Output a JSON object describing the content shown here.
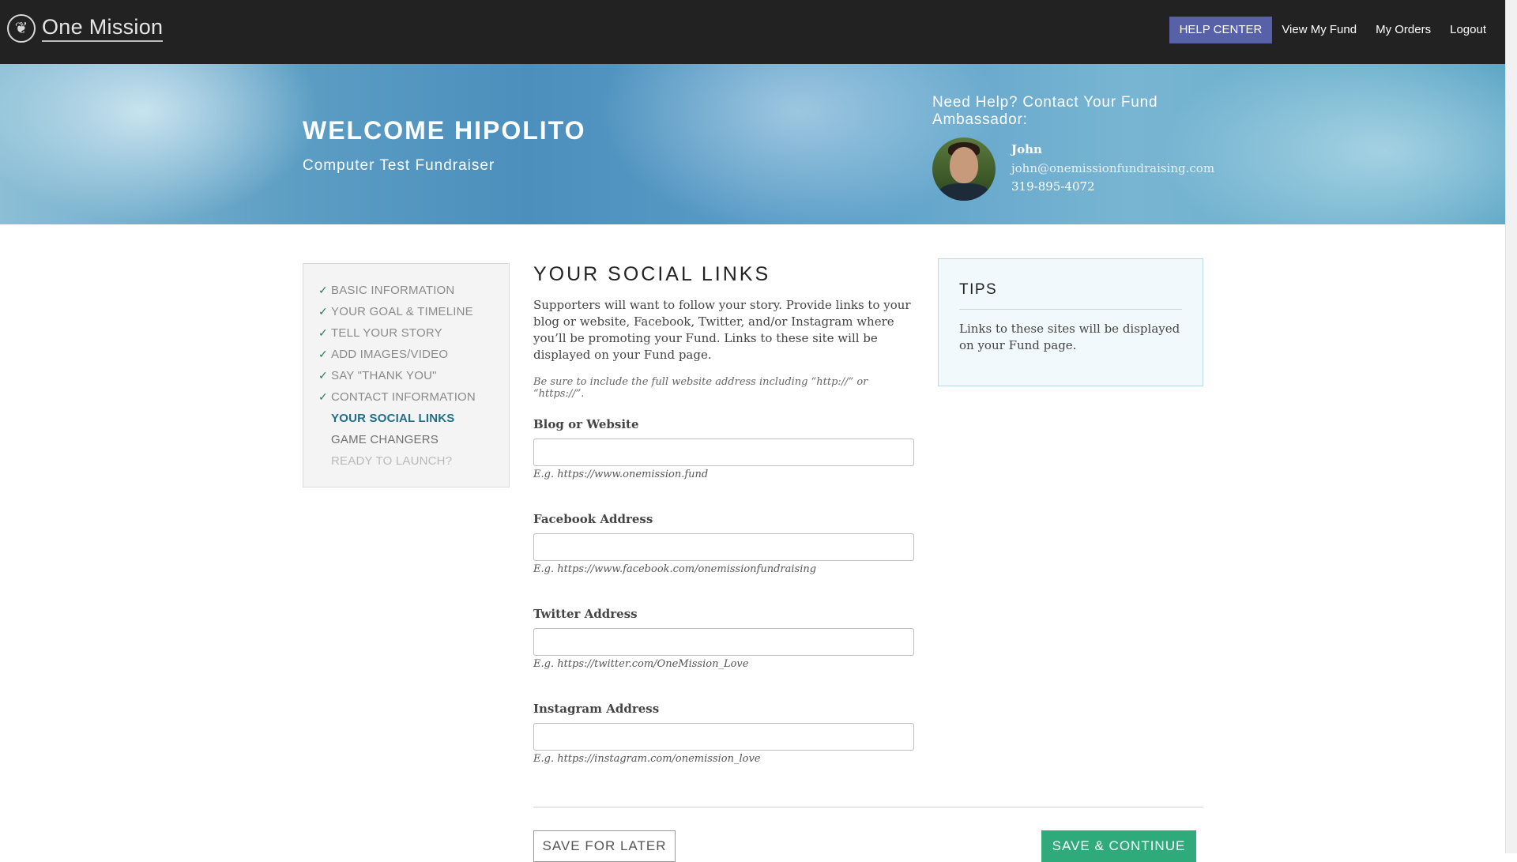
{
  "header": {
    "logo_text": "One Mission",
    "nav": {
      "help_center": "HELP CENTER",
      "view_my_fund": "View My Fund",
      "my_orders": "My Orders",
      "logout": "Logout"
    },
    "colors": {
      "bar": "#222222",
      "help_button": "#5661a8"
    }
  },
  "hero": {
    "welcome": "WELCOME HIPOLITO",
    "fund_name": "Computer Test Fundraiser",
    "help_title": "Need Help? Contact Your Fund Ambassador:",
    "ambassador": {
      "name": "John",
      "email": "john@onemissionfundraising.com",
      "phone": "319-895-4072"
    }
  },
  "steps": [
    {
      "label": "BASIC INFORMATION",
      "state": "done"
    },
    {
      "label": "YOUR GOAL & TIMELINE",
      "state": "done"
    },
    {
      "label": "TELL YOUR STORY",
      "state": "done"
    },
    {
      "label": "ADD IMAGES/VIDEO",
      "state": "done"
    },
    {
      "label": "SAY \"THANK YOU\"",
      "state": "done"
    },
    {
      "label": "CONTACT INFORMATION",
      "state": "done"
    },
    {
      "label": "YOUR SOCIAL LINKS",
      "state": "active"
    },
    {
      "label": "GAME CHANGERS",
      "state": "pending"
    },
    {
      "label": "READY TO LAUNCH?",
      "state": "disabled"
    }
  ],
  "main": {
    "title": "YOUR SOCIAL LINKS",
    "intro": "Supporters will want to follow your story. Provide links to your blog or website, Facebook, Twitter, and/or Instagram where you’ll be promoting your Fund. Links to these site will be displayed on your Fund page.",
    "note": "Be sure to include the full website address including “http://” or “https://”.",
    "fields": [
      {
        "label": "Blog or Website",
        "value": "",
        "hint": "E.g. https://www.onemission.fund"
      },
      {
        "label": "Facebook Address",
        "value": "",
        "hint": "E.g. https://www.facebook.com/onemissionfundraising"
      },
      {
        "label": "Twitter Address",
        "value": "",
        "hint": "E.g. https://twitter.com/OneMission_Love"
      },
      {
        "label": "Instagram Address",
        "value": "",
        "hint": "E.g. https://instagram.com/onemission_love"
      }
    ],
    "save_later": "SAVE FOR LATER",
    "save_continue": "SAVE & CONTINUE"
  },
  "tips": {
    "title": "TIPS",
    "text": "Links to these sites will be displayed on your Fund page."
  },
  "check_glyph": "✓",
  "colors": {
    "active_step": "#1f6f86",
    "continue_button": "#2eaa7b",
    "check": "#2e7d4f"
  }
}
